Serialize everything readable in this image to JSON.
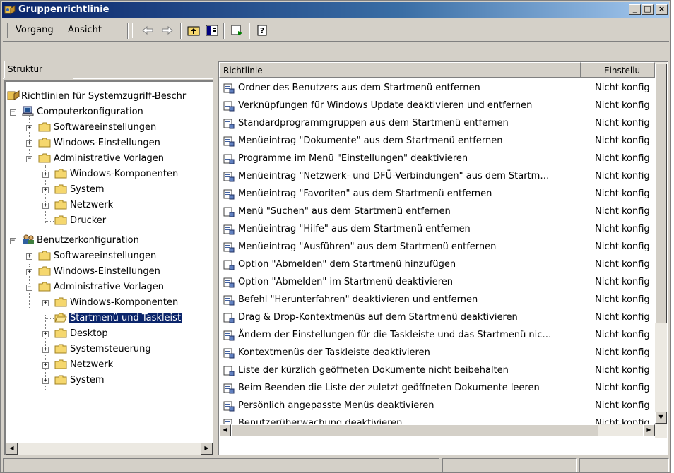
{
  "window": {
    "title": "Gruppenrichtlinie",
    "controls": {
      "minimize": "_",
      "maximize": "□",
      "close": "×"
    }
  },
  "menu": {
    "items": [
      "Vorgang",
      "Ansicht"
    ]
  },
  "toolbar": {
    "back_icon": "back-arrow-icon",
    "forward_icon": "forward-arrow-icon",
    "up_icon": "up-folder-icon",
    "show_tree_icon": "show-hide-tree-icon",
    "export_icon": "export-list-icon",
    "help_icon": "help-icon"
  },
  "tab": {
    "label": "Struktur"
  },
  "tree": {
    "root": "Richtlinien für Systemzugriff-Beschr",
    "computer": "Computerkonfiguration",
    "c_software": "Softwareeinstellungen",
    "c_windows": "Windows-Einstellungen",
    "c_admin": "Administrative Vorlagen",
    "c_wincomp": "Windows-Komponenten",
    "c_system": "System",
    "c_netzwerk": "Netzwerk",
    "c_drucker": "Drucker",
    "user": "Benutzerkonfiguration",
    "u_software": "Softwareeinstellungen",
    "u_windows": "Windows-Einstellungen",
    "u_admin": "Administrative Vorlagen",
    "u_wincomp": "Windows-Komponenten",
    "u_startmenu": "Startmenü und Taskleist",
    "u_desktop": "Desktop",
    "u_systemsteuerung": "Systemsteuerung",
    "u_netzwerk": "Netzwerk",
    "u_system": "System"
  },
  "list": {
    "columns": [
      "Richtlinie",
      "Einstellu"
    ],
    "rows": [
      {
        "name": "Ordner des Benutzers aus dem Startmenü entfernen",
        "state": "Nicht konfig"
      },
      {
        "name": "Verknüpfungen für Windows Update deaktivieren und entfernen",
        "state": "Nicht konfig"
      },
      {
        "name": "Standardprogrammgruppen aus dem Startmenü entfernen",
        "state": "Nicht konfig"
      },
      {
        "name": "Menüeintrag \"Dokumente\" aus dem Startmenü entfernen",
        "state": "Nicht konfig"
      },
      {
        "name": "Programme im Menü \"Einstellungen\" deaktivieren",
        "state": "Nicht konfig"
      },
      {
        "name": "Menüeintrag \"Netzwerk- und DFÜ-Verbindungen\" aus dem Startm…",
        "state": "Nicht konfig"
      },
      {
        "name": "Menüeintrag \"Favoriten\" aus dem Startmenü entfernen",
        "state": "Nicht konfig"
      },
      {
        "name": "Menü \"Suchen\" aus dem Startmenü entfernen",
        "state": "Nicht konfig"
      },
      {
        "name": "Menüeintrag \"Hilfe\" aus dem Startmenü entfernen",
        "state": "Nicht konfig"
      },
      {
        "name": "Menüeintrag \"Ausführen\" aus dem Startmenü entfernen",
        "state": "Nicht konfig"
      },
      {
        "name": "Option \"Abmelden\" dem Startmenü hinzufügen",
        "state": "Nicht konfig"
      },
      {
        "name": "Option \"Abmelden\" im Startmenü deaktivieren",
        "state": "Nicht konfig"
      },
      {
        "name": "Befehl \"Herunterfahren\" deaktivieren und entfernen",
        "state": "Nicht konfig"
      },
      {
        "name": "Drag & Drop-Kontextmenüs auf dem Startmenü deaktivieren",
        "state": "Nicht konfig"
      },
      {
        "name": "Ändern der Einstellungen für die Taskleiste und das Startmenü nic…",
        "state": "Nicht konfig"
      },
      {
        "name": "Kontextmenüs der Taskleiste deaktivieren",
        "state": "Nicht konfig"
      },
      {
        "name": "Liste der kürzlich geöffneten Dokumente nicht beibehalten",
        "state": "Nicht konfig"
      },
      {
        "name": "Beim Beenden die Liste der zuletzt geöffneten Dokumente leeren",
        "state": "Nicht konfig"
      },
      {
        "name": "Persönlich angepasste Menüs deaktivieren",
        "state": "Nicht konfig"
      },
      {
        "name": "Benutzerüberwachung deaktivieren",
        "state": "Nicht konfig"
      }
    ]
  },
  "colors": {
    "title_gradient_start": "#0a246a",
    "title_gradient_end": "#a6caf0",
    "selection": "#0a246a",
    "face": "#d4d0c8",
    "folder": "#f5d76e"
  }
}
